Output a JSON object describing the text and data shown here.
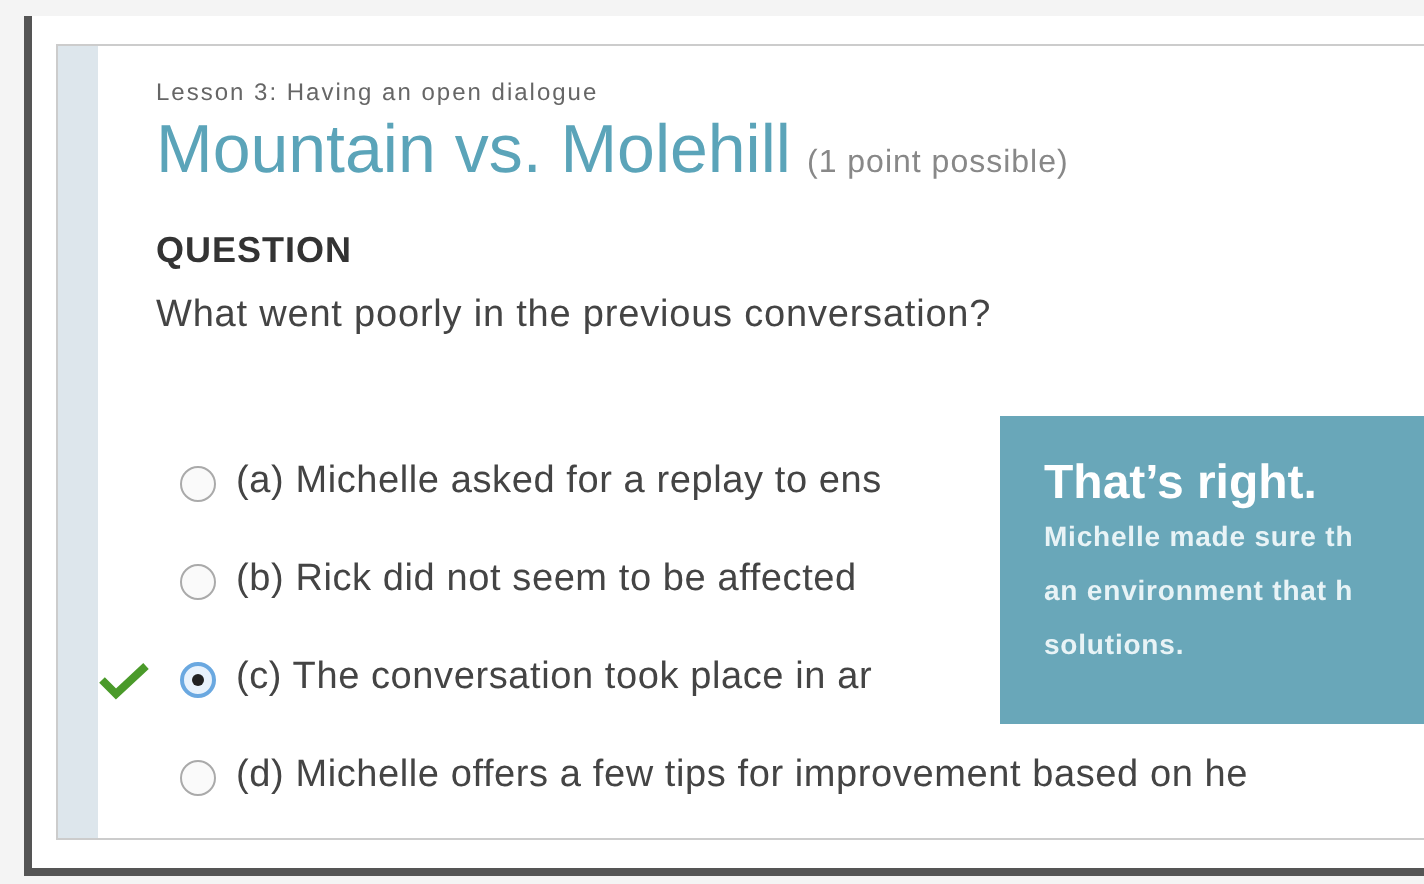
{
  "lesson": "Lesson 3: Having an open dialogue",
  "title": "Mountain vs. Molehill",
  "points": "(1 point possible)",
  "question_heading": "QUESTION",
  "question": "What went poorly in the previous conversation?",
  "options": [
    {
      "label": "(a) Michelle asked for a replay to ens",
      "selected": false,
      "correct": false
    },
    {
      "label": "(b) Rick did not seem to be affected",
      "selected": false,
      "correct": false
    },
    {
      "label": "(c) The conversation took place in ar",
      "selected": true,
      "correct": true
    },
    {
      "label": "(d) Michelle offers a few tips for improvement based on he",
      "selected": false,
      "correct": false
    }
  ],
  "feedback": {
    "heading": "That’s right.",
    "lines": [
      "Michelle made sure th",
      "an environment that h",
      "solutions."
    ]
  }
}
